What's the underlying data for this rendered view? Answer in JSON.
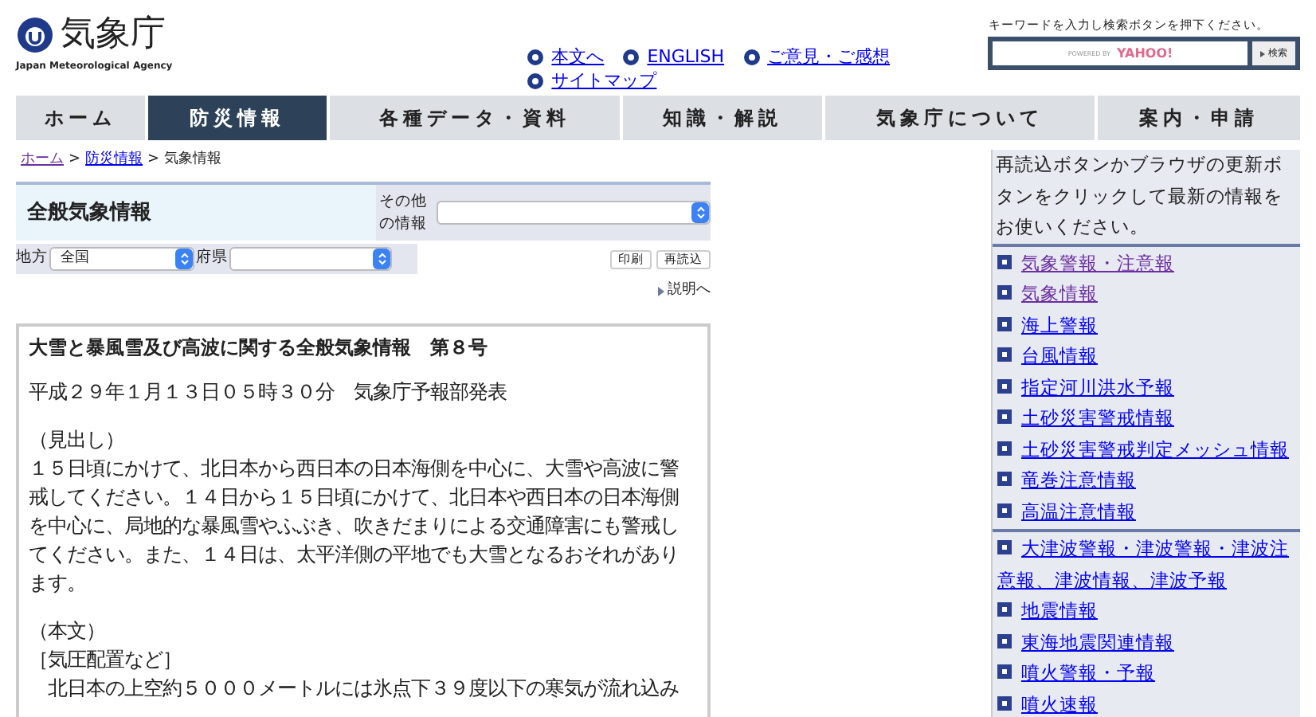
{
  "logo": {
    "name": "気象庁",
    "subtitle": "Japan Meteorological Agency"
  },
  "header_links": [
    {
      "label": "本文へ"
    },
    {
      "label": "ENGLISH"
    },
    {
      "label": "ご意見・ご感想"
    },
    {
      "label": "サイトマップ"
    }
  ],
  "search": {
    "hint": "キーワードを入力し検索ボタンを押下ください。",
    "powered_by": "POWERED BY",
    "brand": "YAHOO!",
    "button": "検索"
  },
  "nav_tabs": [
    {
      "label": "ホーム",
      "selected": false
    },
    {
      "label": "防災情報",
      "selected": true
    },
    {
      "label": "各種データ・資料",
      "selected": false
    },
    {
      "label": "知識・解説",
      "selected": false
    },
    {
      "label": "気象庁について",
      "selected": false
    },
    {
      "label": "案内・申請",
      "selected": false
    }
  ],
  "breadcrumb": {
    "separator": ">",
    "items": [
      {
        "label": "ホーム",
        "kind": "link",
        "visited": true
      },
      {
        "label": "防災情報",
        "kind": "link",
        "visited": false
      },
      {
        "label": "気象情報",
        "kind": "text"
      }
    ]
  },
  "page_title": "全般気象情報",
  "other_info": {
    "label": "その他の情報"
  },
  "filters": [
    {
      "label": "地方",
      "value": "全国"
    },
    {
      "label": "府県"
    }
  ],
  "buttons": [
    "印刷",
    "再読込"
  ],
  "help_link": "説明へ",
  "bulletin": {
    "title": "大雪と暴風雪及び高波に関する全般気象情報　第８号",
    "issued": "平成２９年１月１３日０５時３０分　気象庁予報部発表",
    "sections": [
      {
        "heading": "（見出し）",
        "lines": [
          "１５日頃にかけて、北日本から西日本の日本海側を中心に、大雪や高波に警戒してください。１４日から１５日頃にかけて、北日本や西日本の日本海側を中心に、局地的な暴風雪やふぶき、吹きだまりによる交通障害にも警戒してください。また、１４日は、太平洋側の平地でも大雪となるおそれがあります。"
        ]
      },
      {
        "heading": "（本文）",
        "lines": [
          "［気圧配置など］",
          "　北日本の上空約５０００メートルには氷点下３９度以下の寒気が流れ込み"
        ]
      }
    ]
  },
  "sidebar": {
    "notice": "再読込ボタンかブラウザの更新ボタンをクリックして最新の情報をお使いください。",
    "groups": [
      [
        {
          "label": "気象警報・注意報",
          "visited": true
        },
        {
          "label": "気象情報",
          "visited": true
        },
        {
          "label": "海上警報",
          "visited": false
        },
        {
          "label": "台風情報",
          "visited": false
        },
        {
          "label": "指定河川洪水予報",
          "visited": false
        },
        {
          "label": "土砂災害警戒情報",
          "visited": false
        },
        {
          "label": "土砂災害警戒判定メッシュ情報",
          "visited": false
        },
        {
          "label": "竜巻注意情報",
          "visited": false
        },
        {
          "label": "高温注意情報",
          "visited": false
        }
      ],
      [
        {
          "label": "大津波警報・津波警報・津波注意報、津波情報、津波予報",
          "visited": false
        },
        {
          "label": "地震情報",
          "visited": false
        },
        {
          "label": "東海地震関連情報",
          "visited": false
        },
        {
          "label": "噴火警報・予報",
          "visited": false
        },
        {
          "label": "噴火速報",
          "visited": false
        }
      ]
    ]
  }
}
